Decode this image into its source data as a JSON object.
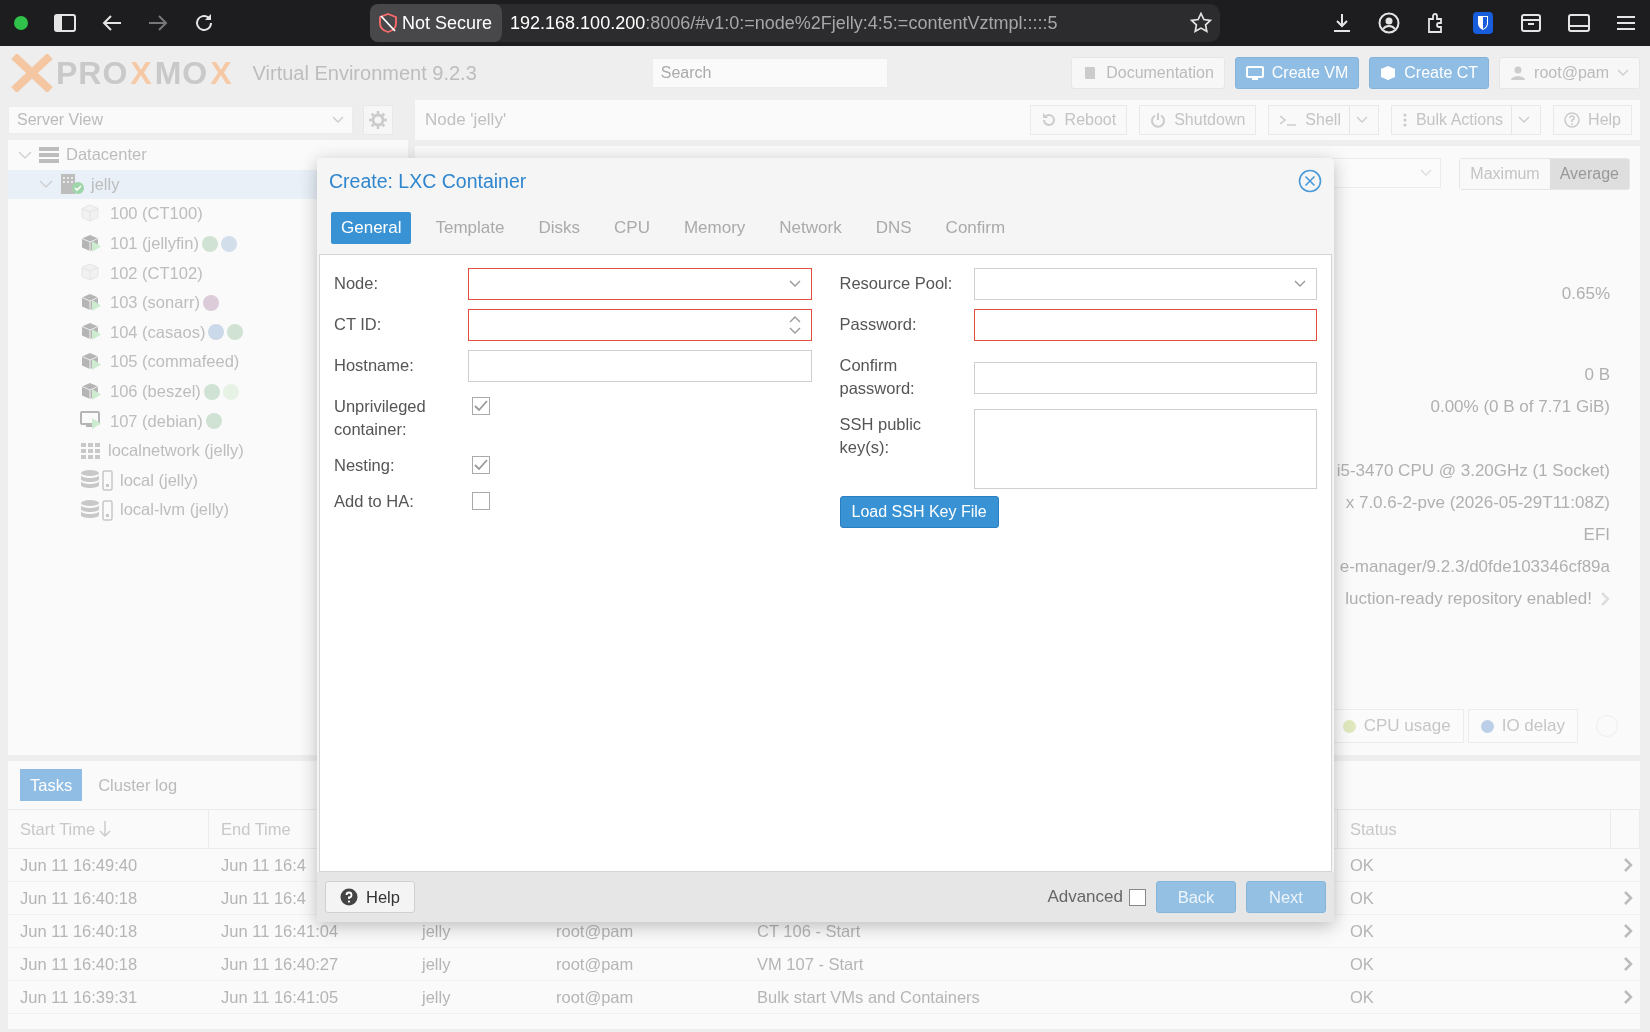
{
  "browser": {
    "security": "Not Secure",
    "host": "192.168.100.200",
    "path": ":8006/#v1:0:=node%2Fjelly:4:5:=contentVztmpl:::::5"
  },
  "header": {
    "logo": [
      {
        "text": "PRO",
        "accent": false
      },
      {
        "text": "X",
        "accent": true
      },
      {
        "text": "MO",
        "accent": false
      },
      {
        "text": "X",
        "accent": true
      }
    ],
    "product": "Virtual Environment 9.2.3",
    "search": {
      "placeholder": "Search"
    },
    "buttons": [
      {
        "label": "Documentation",
        "kind": "book",
        "primary": false
      },
      {
        "label": "Create VM",
        "kind": "monitor",
        "primary": true
      },
      {
        "label": "Create CT",
        "kind": "cube",
        "primary": true
      },
      {
        "label": "root@pam",
        "kind": "user",
        "primary": false
      }
    ]
  },
  "sidebar": {
    "view": "Server View",
    "tree": [
      {
        "label": "Datacenter",
        "kind": "datacenter",
        "expanded": true,
        "selected": false,
        "children": [
          {
            "label": "jelly",
            "kind": "node",
            "expanded": true,
            "selected": true,
            "children": [
              {
                "label": "100 (CT100)",
                "kind": "ct",
                "running": false,
                "selected": false
              },
              {
                "label": "101 (jellyfin)",
                "kind": "ct",
                "running": true,
                "selected": false,
                "tags": [
                  {
                    "color": "#cfe2d3"
                  },
                  {
                    "color": "#d3deeb"
                  }
                ]
              },
              {
                "label": "102 (CT102)",
                "kind": "ct",
                "running": false,
                "selected": false
              },
              {
                "label": "103 (sonarr)",
                "kind": "ct",
                "running": true,
                "selected": false,
                "tags": [
                  {
                    "color": "#dccbd8"
                  }
                ]
              },
              {
                "label": "104 (casaos)",
                "kind": "ct",
                "running": true,
                "selected": false,
                "tags": [
                  {
                    "color": "#ccd9ea"
                  },
                  {
                    "color": "#cfe2d3"
                  }
                ]
              },
              {
                "label": "105 (commafeed)",
                "kind": "ct",
                "running": true,
                "selected": false
              },
              {
                "label": "106 (beszel)",
                "kind": "ct",
                "running": true,
                "selected": false,
                "tags": [
                  {
                    "color": "#cfe2d3"
                  },
                  {
                    "color": "#e6f2e3"
                  }
                ]
              },
              {
                "label": "107 (debian)",
                "kind": "vm",
                "running": true,
                "selected": false,
                "tags": [
                  {
                    "color": "#cfe2d3"
                  }
                ]
              },
              {
                "label": "localnetwork (jelly)",
                "kind": "network",
                "selected": false
              },
              {
                "label": "local (jelly)",
                "kind": "storage",
                "selected": false
              },
              {
                "label": "local-lvm (jelly)",
                "kind": "storage",
                "selected": false
              }
            ]
          }
        ]
      }
    ]
  },
  "node_panel": {
    "title": "Node 'jelly'",
    "buttons": [
      {
        "label": "Reboot",
        "kind": "reboot",
        "menu": false
      },
      {
        "label": "Shutdown",
        "kind": "power",
        "menu": false
      },
      {
        "label": "Shell",
        "kind": "terminal",
        "menu": true
      },
      {
        "label": "Bulk Actions",
        "kind": "dots",
        "menu": true
      },
      {
        "label": "Help",
        "kind": "help",
        "menu": false
      }
    ],
    "range_buttons": [
      {
        "label": "Maximum",
        "selected": false
      },
      {
        "label": "Average",
        "selected": true
      }
    ],
    "stats": [
      [
        {
          "text": "0.65%",
          "more": false
        }
      ],
      [
        {
          "text": "0 B",
          "more": false
        },
        {
          "text": "0.00% (0 B of 7.71 GiB)",
          "more": false
        }
      ],
      [
        {
          "text": "i5-3470 CPU @ 3.20GHz (1 Socket)",
          "more": false
        },
        {
          "text": "x 7.0.6-2-pve (2026-05-29T11:08Z)",
          "more": false
        },
        {
          "text": "EFI",
          "more": false
        },
        {
          "text": "e-manager/9.2.3/d0fde103346cf89a",
          "more": false
        },
        {
          "text": "luction-ready repository enabled!",
          "more": true
        }
      ]
    ],
    "legend": [
      {
        "label": "CPU usage",
        "color": "#dfe8bd"
      },
      {
        "label": "IO delay",
        "color": "#bccfe8"
      }
    ]
  },
  "tasks": {
    "tabs": [
      {
        "label": "Tasks",
        "selected": true
      },
      {
        "label": "Cluster log",
        "selected": false
      }
    ],
    "columns": {
      "start_time": {
        "label": "Start Time",
        "sorted": true
      },
      "end_time": {
        "label": "End Time",
        "sorted": false
      },
      "status": {
        "label": "Status",
        "sorted": false
      }
    },
    "rows": [
      {
        "start_time": "Jun 11 16:49:40",
        "end_time": "Jun 11 16:4",
        "status": "OK"
      },
      {
        "start_time": "Jun 11 16:40:18",
        "end_time": "Jun 11 16:4",
        "status": "OK"
      },
      {
        "start_time": "Jun 11 16:40:18",
        "end_time": "Jun 11 16:41:04",
        "column_3": "jelly",
        "column_4": "root@pam",
        "column_5": "CT 106 - Start",
        "status": "OK"
      },
      {
        "start_time": "Jun 11 16:40:18",
        "end_time": "Jun 11 16:40:27",
        "column_3": "jelly",
        "column_4": "root@pam",
        "column_5": "VM 107 - Start",
        "status": "OK"
      },
      {
        "start_time": "Jun 11 16:39:31",
        "end_time": "Jun 11 16:41:05",
        "column_3": "jelly",
        "column_4": "root@pam",
        "column_5": "Bulk start VMs and Containers",
        "status": "OK"
      }
    ]
  },
  "dialog": {
    "title": "Create: LXC Container",
    "tabs": [
      {
        "label": "General",
        "selected": true
      },
      {
        "label": "Template",
        "selected": false
      },
      {
        "label": "Disks",
        "selected": false
      },
      {
        "label": "CPU",
        "selected": false
      },
      {
        "label": "Memory",
        "selected": false
      },
      {
        "label": "Network",
        "selected": false
      },
      {
        "label": "DNS",
        "selected": false
      },
      {
        "label": "Confirm",
        "selected": false
      }
    ],
    "left_fields": [
      {
        "label": "Node:",
        "kind": "select",
        "invalid": true
      },
      {
        "label": "CT ID:",
        "kind": "spinner",
        "invalid": true
      },
      {
        "label": "Hostname:",
        "kind": "text",
        "invalid": false
      },
      {
        "label": "Unprivileged container:",
        "kind": "checkbox",
        "checked": true
      },
      {
        "label": "Nesting:",
        "kind": "checkbox",
        "checked": true
      },
      {
        "label": "Add to HA:",
        "kind": "checkbox",
        "checked": false
      }
    ],
    "right_fields": [
      {
        "label": "Resource Pool:",
        "kind": "select",
        "invalid": false
      },
      {
        "label": "Password:",
        "kind": "text",
        "invalid": true
      },
      {
        "label": "Confirm password:",
        "kind": "text",
        "invalid": false
      },
      {
        "label": "SSH public key(s):",
        "kind": "textarea",
        "invalid": false
      }
    ],
    "load_button": "Load SSH Key File",
    "help": "Help",
    "advanced": {
      "label": "Advanced",
      "checked": false
    },
    "back": "Back",
    "next": "Next"
  }
}
